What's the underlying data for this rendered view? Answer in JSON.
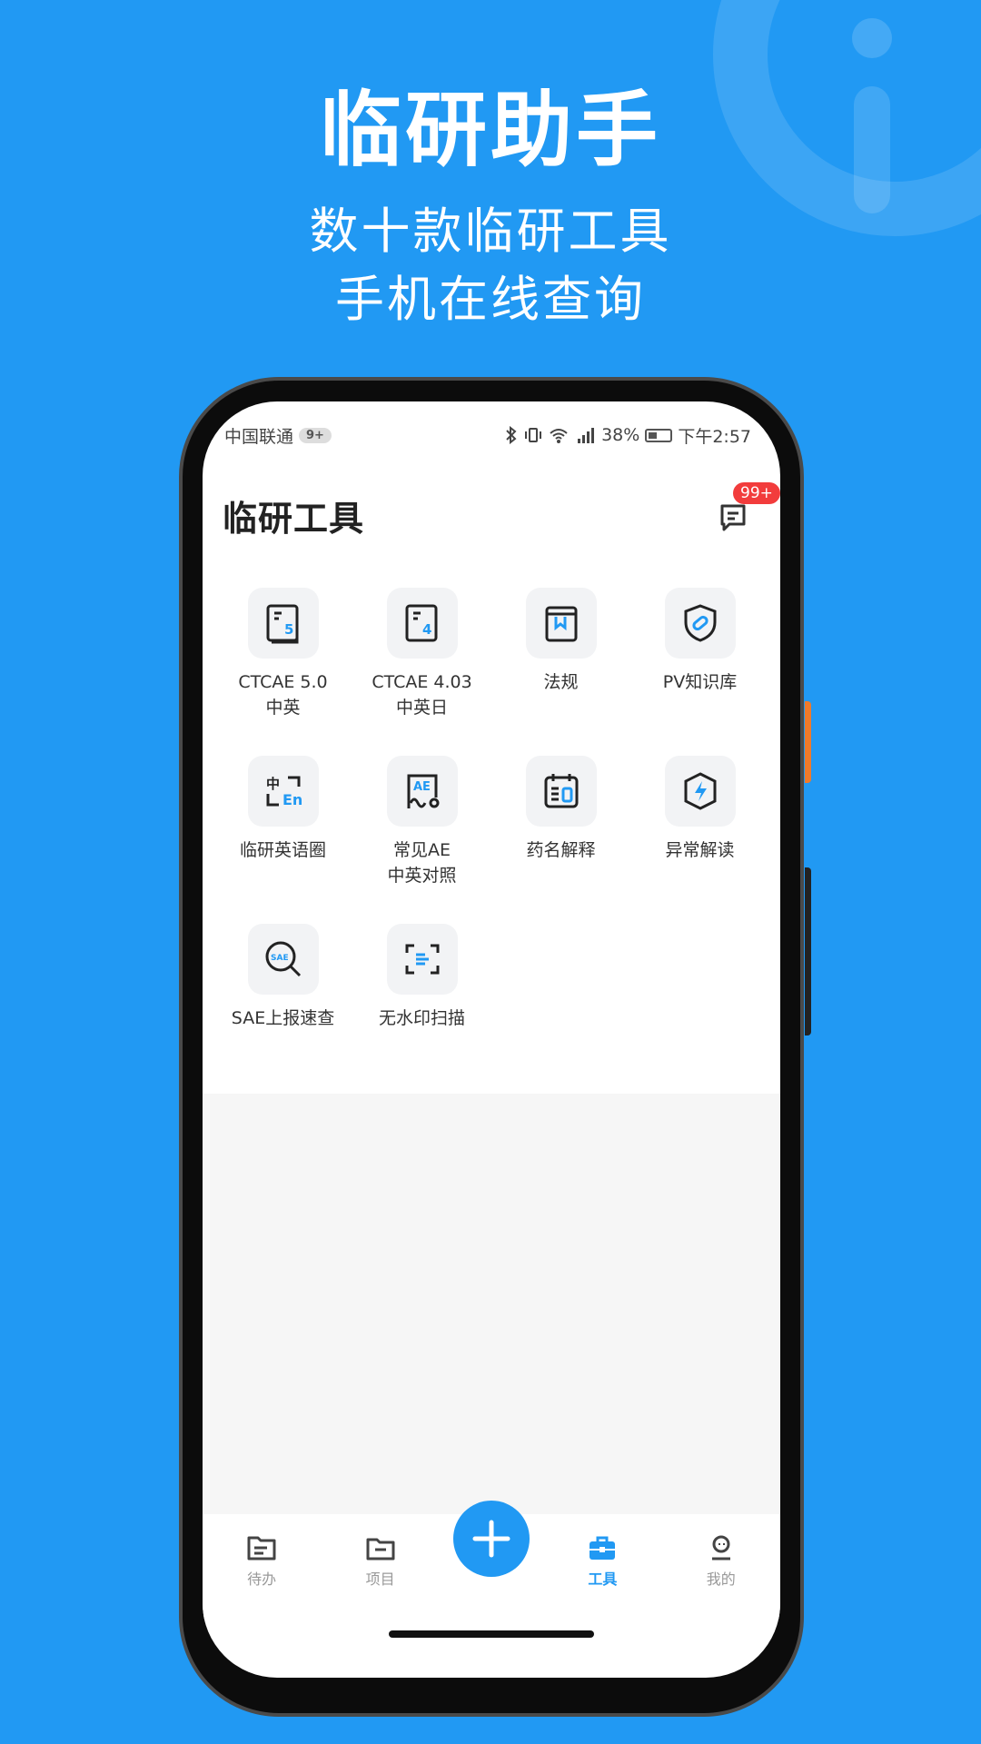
{
  "hero": {
    "title": "临研助手",
    "subtitle_line1": "数十款临研工具",
    "subtitle_line2": "手机在线查询"
  },
  "status_bar": {
    "carrier": "中国联通",
    "notif_badge": "9+",
    "battery_percent": "38%",
    "time": "下午2:57"
  },
  "header": {
    "title": "临研工具",
    "message_badge": "99+"
  },
  "tools": [
    {
      "label": "CTCAE 5.0\n中英",
      "icon": "book-5-icon"
    },
    {
      "label": "CTCAE 4.03\n中英日",
      "icon": "book-4-icon"
    },
    {
      "label": "法规",
      "icon": "bookmark-book-icon"
    },
    {
      "label": "PV知识库",
      "icon": "shield-pill-icon"
    },
    {
      "label": "临研英语圈",
      "icon": "translate-icon"
    },
    {
      "label": "常见AE\n中英对照",
      "icon": "ae-document-icon"
    },
    {
      "label": "药名解释",
      "icon": "drug-calendar-icon"
    },
    {
      "label": "异常解读",
      "icon": "lightning-shield-icon"
    },
    {
      "label": "SAE上报速查",
      "icon": "sae-search-icon"
    },
    {
      "label": "无水印扫描",
      "icon": "scan-icon"
    }
  ],
  "tabbar": {
    "todo": "待办",
    "projects": "项目",
    "tools": "工具",
    "mine": "我的"
  },
  "colors": {
    "brand": "#2199f3",
    "badge_red": "#f23c3c"
  }
}
